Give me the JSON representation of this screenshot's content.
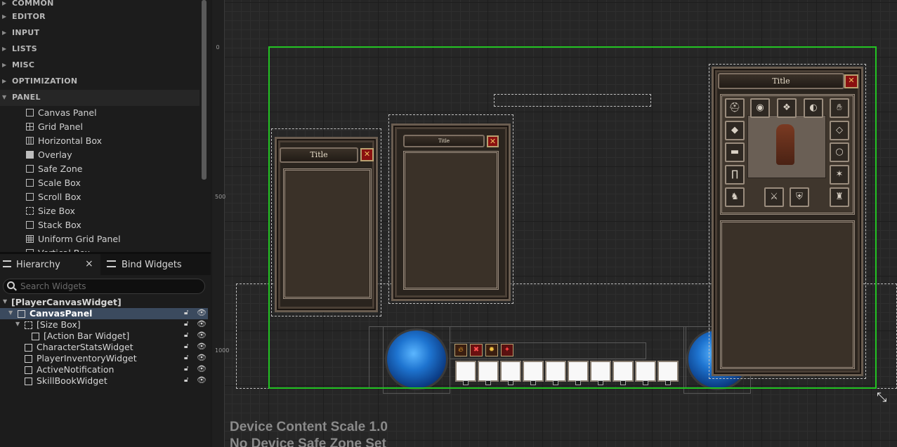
{
  "palette": {
    "categories": [
      "COMMON",
      "EDITOR",
      "INPUT",
      "LISTS",
      "MISC",
      "OPTIMIZATION",
      "PANEL"
    ],
    "panel_items": [
      "Canvas Panel",
      "Grid Panel",
      "Horizontal Box",
      "Overlay",
      "Safe Zone",
      "Scale Box",
      "Scroll Box",
      "Size Box",
      "Stack Box",
      "Uniform Grid Panel",
      "Vertical Box"
    ]
  },
  "hierarchy": {
    "tab_label": "Hierarchy",
    "bind_tab_label": "Bind Widgets",
    "search_placeholder": "Search Widgets",
    "rows": [
      "[PlayerCanvasWidget]",
      "CanvasPanel",
      "[Size Box]",
      "[Action Bar Widget]",
      "CharacterStatsWidget",
      "PlayerInventoryWidget",
      "ActiveNotification",
      "SkillBookWidget"
    ]
  },
  "designer": {
    "ruler_marks": [
      "0",
      "500",
      "1000"
    ],
    "panel1_title": "Title",
    "panel2_title": "Title",
    "panel3_title": "Title",
    "device_scale": "Device Content Scale 1.0",
    "safe_zone": "No Device Safe Zone Set"
  },
  "colors": {
    "canvas_outline": "#22c322",
    "selection_row": "#3b4a5e",
    "orb_blue": "#1e74d0",
    "close_red": "#8a1010"
  }
}
